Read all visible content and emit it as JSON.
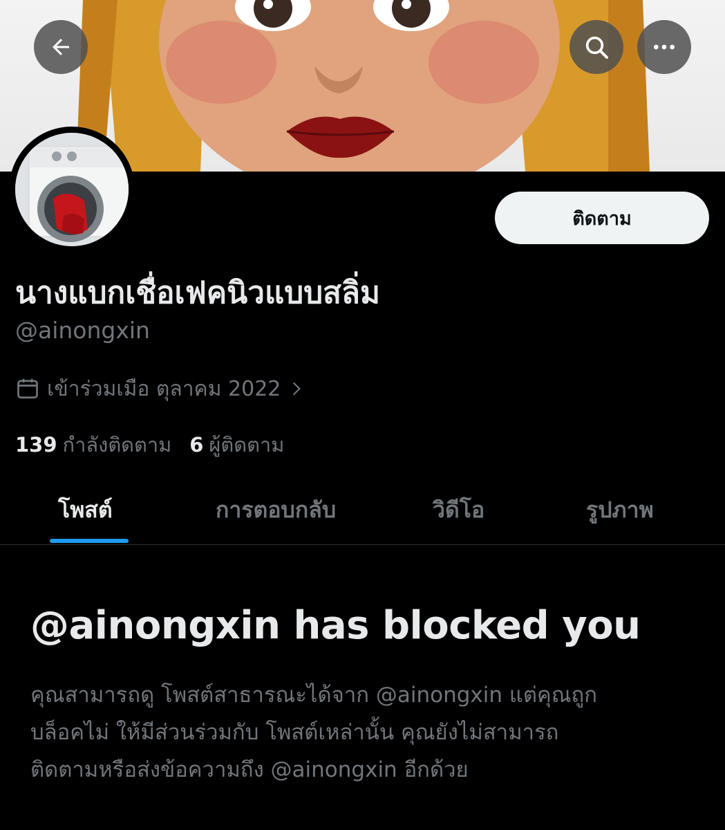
{
  "header": {
    "back_icon": "arrow-left-icon",
    "search_icon": "search-icon",
    "more_icon": "more-horizontal-icon"
  },
  "profile": {
    "follow_label": "ติดตาม",
    "display_name": "นางแบกเชื่อเฟคนิวแบบสลิ่ม",
    "handle": "@ainongxin",
    "joined": "เข้าร่วมเมือ ตุลาคม 2022",
    "following_count": "139",
    "following_label": "กำลังติดตาม",
    "followers_count": "6",
    "followers_label": "ผู้ติดตาม"
  },
  "tabs": [
    "โพสต์",
    "การตอบกลับ",
    "วิดีโอ",
    "รูปภาพ"
  ],
  "blocked": {
    "title": "@ainongxin has blocked you",
    "lines": [
      "คุณสามารถดู โพสต์สาธารณะได้จาก @ainongxin แต่คุณถูก",
      "บล็อคไม่ ให้มีส่วนร่วมกับ โพสต์เหล่านั้น คุณยังไม่สามารถ",
      "ติดตามหรือส่งข้อความถึง @ainongxin อีกด้วย"
    ]
  },
  "colors": {
    "background": "#000000",
    "accent": "#1d9bf0",
    "secondary_text": "#71767b",
    "primary_text": "#e7e9ea",
    "follow_button_bg": "#eff3f4"
  }
}
